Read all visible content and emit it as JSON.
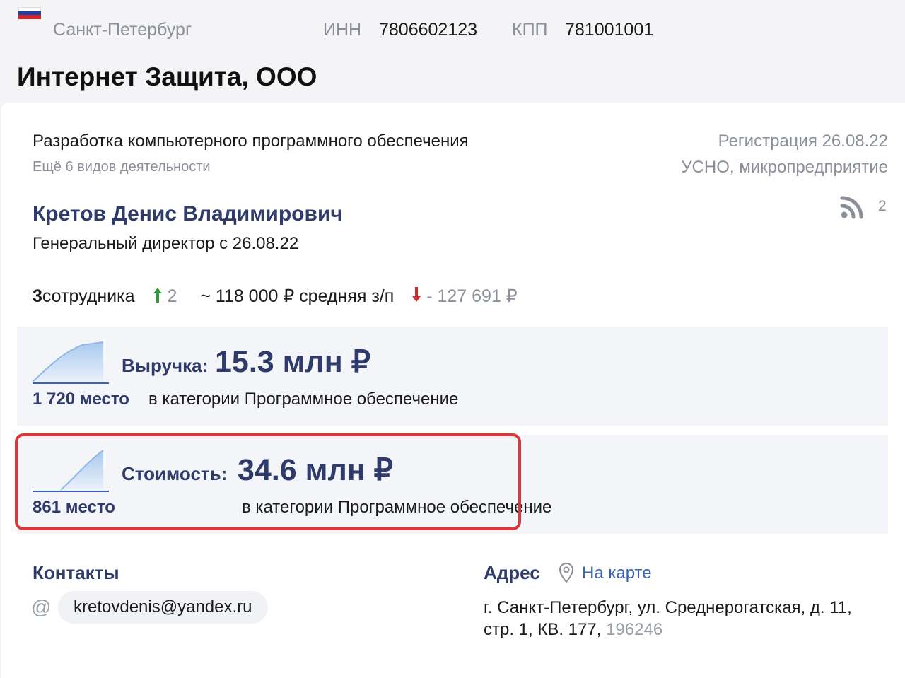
{
  "header": {
    "flag_colors": [
      "#ffffff",
      "#1f3fa6",
      "#d3252a"
    ],
    "city": "Санкт-Петербург",
    "inn_label": "ИНН",
    "inn_value": "7806602123",
    "kpp_label": "КПП",
    "kpp_value": "781001001",
    "company_name": "Интернет Защита, ООО"
  },
  "profile": {
    "activity": "Разработка компьютерного программного обеспечения",
    "more_activities": "Ещё 6 видов деятельности",
    "registration": "Регистрация 26.08.22",
    "tax_regime": "УСНО, микропредприятие",
    "director_name": "Кретов Денис Владимирович",
    "director_role": "Генеральный директор с 26.08.22",
    "subscribers_icon": "rss-icon",
    "subscribers_count": "2"
  },
  "stats": {
    "employees_count": "3",
    "employees_label": " сотрудника",
    "employees_change": "2",
    "salary": "~ 118 000 ₽ средняя з/п",
    "salary_change": "- 127 691 ₽",
    "colors": {
      "up": "#2e9b3c",
      "down": "#cc2a2a"
    }
  },
  "revenue": {
    "label": "Выручка:",
    "value": "15.3 млн ₽",
    "rank": "1 720 место",
    "category": "в категории Программное обеспечение"
  },
  "valuation": {
    "label": "Стоимость:",
    "value": "34.6 млн ₽",
    "rank": "861 место",
    "category": "в категории Программное обеспечение",
    "highlight_color": "#e0363a"
  },
  "contacts": {
    "title": "Контакты",
    "email_icon": "at-icon",
    "email": "kretovdenis@yandex.ru"
  },
  "address": {
    "title": "Адрес",
    "map_icon": "map-pin-icon",
    "map_link": "На карте",
    "text": "г. Санкт-Петербург, ул. Среднерогатская, д. 11, стр. 1, КВ. 177,",
    "zip": "196246"
  },
  "accent_color": "#2f3b6b"
}
